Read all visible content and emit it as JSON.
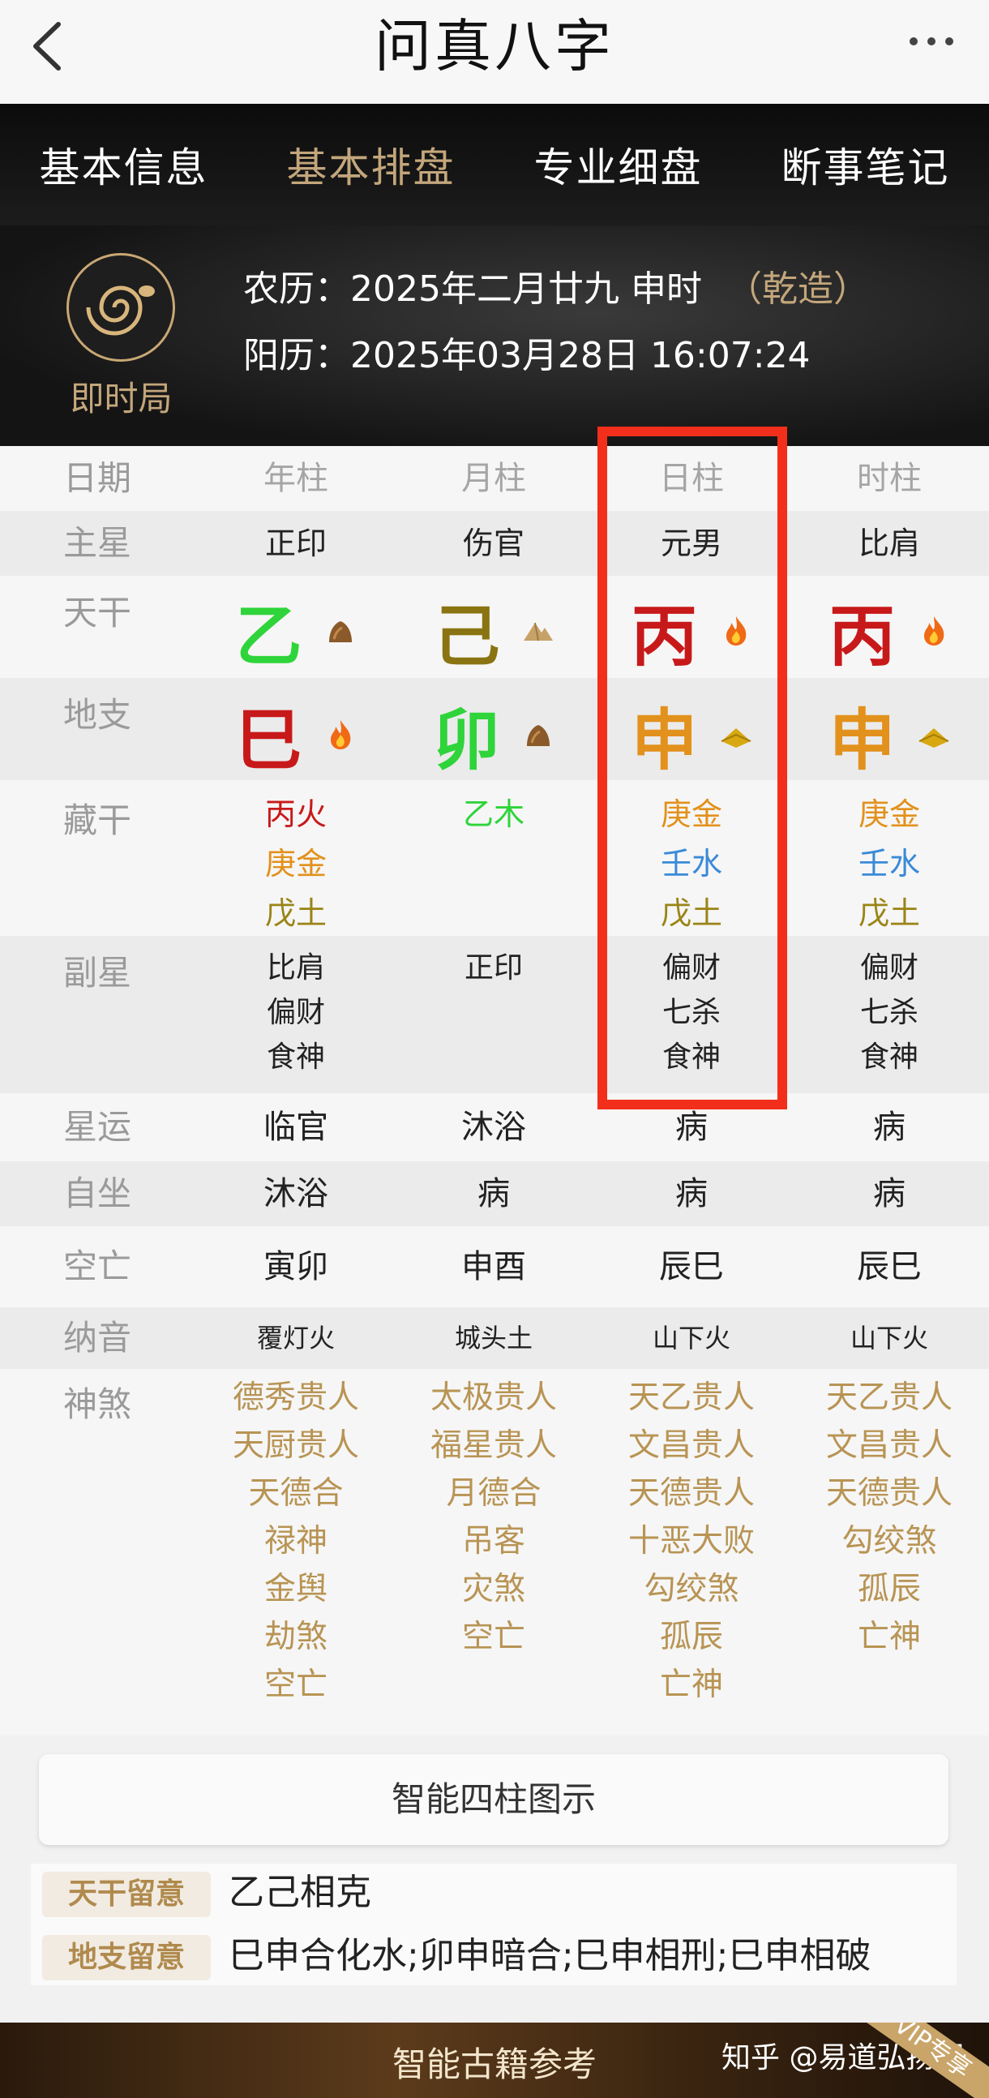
{
  "header": {
    "title": "问真八字",
    "back_icon": "chevron-left-icon",
    "more_icon": "more-horizontal-icon"
  },
  "tabs": [
    "基本信息",
    "基本排盘",
    "专业细盘",
    "断事笔记"
  ],
  "active_tab": "基本排盘",
  "info": {
    "mode_label": "即时局",
    "logo_icon": "snake-zodiac-icon",
    "lunar_label": "农历：",
    "lunar_value": "2025年二月廿九 申时",
    "gender": "（乾造）",
    "solar_label": "阳历：",
    "solar_value": "2025年03月28日 16:07:24"
  },
  "table": {
    "header_label": "日期",
    "columns": [
      "年柱",
      "月柱",
      "日柱",
      "时柱"
    ],
    "main_star": {
      "label": "主星",
      "values": [
        "正印",
        "伤官",
        "元男",
        "比肩"
      ]
    },
    "tiangan": {
      "label": "天干",
      "values": [
        "乙",
        "己",
        "丙",
        "丙"
      ],
      "icons": [
        "wood-element-icon",
        "earth-element-icon",
        "fire-element-icon",
        "fire-element-icon"
      ]
    },
    "dizhi": {
      "label": "地支",
      "values": [
        "巳",
        "卯",
        "申",
        "申"
      ],
      "icons": [
        "fire-element-icon",
        "wood-element-icon",
        "metal-element-icon",
        "metal-element-icon"
      ]
    },
    "canggan": {
      "label": "藏干",
      "values": [
        [
          "丙火",
          "庚金",
          "戊土"
        ],
        [
          "乙木"
        ],
        [
          "庚金",
          "壬水",
          "戊土"
        ],
        [
          "庚金",
          "壬水",
          "戊土"
        ]
      ]
    },
    "fuxing": {
      "label": "副星",
      "values": [
        [
          "比肩",
          "偏财",
          "食神"
        ],
        [
          "正印"
        ],
        [
          "偏财",
          "七杀",
          "食神"
        ],
        [
          "偏财",
          "七杀",
          "食神"
        ]
      ]
    },
    "xingyun": {
      "label": "星运",
      "values": [
        "临官",
        "沐浴",
        "病",
        "病"
      ]
    },
    "zizuo": {
      "label": "自坐",
      "values": [
        "沐浴",
        "病",
        "病",
        "病"
      ]
    },
    "kongwang": {
      "label": "空亡",
      "values": [
        "寅卯",
        "申酉",
        "辰巳",
        "辰巳"
      ]
    },
    "nayin": {
      "label": "纳音",
      "values": [
        "覆灯火",
        "城头土",
        "山下火",
        "山下火"
      ]
    },
    "shensha": {
      "label": "神煞",
      "values": [
        [
          "德秀贵人",
          "天厨贵人",
          "天德合",
          "禄神",
          "金舆",
          "劫煞",
          "空亡"
        ],
        [
          "太极贵人",
          "福星贵人",
          "月德合",
          "吊客",
          "灾煞",
          "空亡"
        ],
        [
          "天乙贵人",
          "文昌贵人",
          "天德贵人",
          "十恶大败",
          "勾绞煞",
          "孤辰",
          "亡神"
        ],
        [
          "天乙贵人",
          "文昌贵人",
          "天德贵人",
          "勾绞煞",
          "孤辰",
          "亡神"
        ]
      ]
    }
  },
  "diagram_button": "智能四柱图示",
  "notes": {
    "tiangan_tag": "天干留意",
    "tiangan_text": "乙己相克",
    "dizhi_tag": "地支留意",
    "dizhi_text": "巳申合化水;卯申暗合;巳申相刑;巳申相破"
  },
  "bottom": {
    "label": "智能古籍参考",
    "watermark": "知乎 @易道弘扬阁",
    "ribbon": "VIP专享"
  },
  "colors": {
    "accent_gold": "#c3a67b",
    "highlight_red": "#f22f1a",
    "fire_red": "#c8191a",
    "wood_green": "#2fd43a",
    "earth_olive": "#8a7412",
    "metal_orange": "#e2911c",
    "water_blue": "#3a8ad8"
  }
}
